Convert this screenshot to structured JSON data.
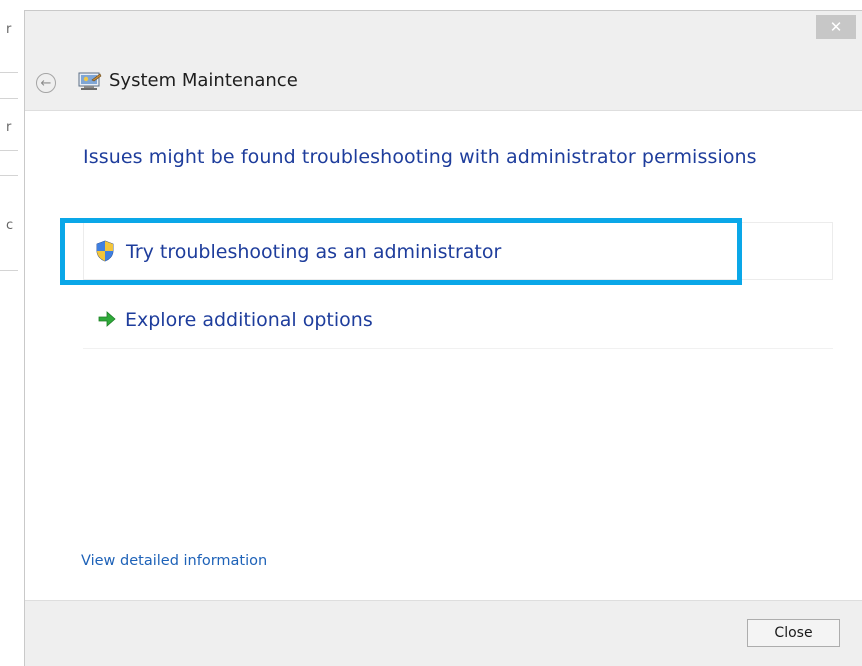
{
  "window": {
    "close_glyph": "✕",
    "title": "System Maintenance",
    "back_glyph": "←"
  },
  "content": {
    "heading": "Issues might be found troubleshooting with administrator permissions",
    "options": [
      {
        "label": "Try troubleshooting as an administrator",
        "icon": "uac-shield-icon",
        "highlighted": true
      },
      {
        "label": "Explore additional options",
        "icon": "green-arrow-icon",
        "highlighted": false
      }
    ],
    "detail_link": "View detailed information"
  },
  "footer": {
    "close_label": "Close"
  },
  "background_window": {
    "glyphs": [
      "r",
      "r",
      "c"
    ]
  },
  "colors": {
    "accent_link": "#1e3d9c",
    "highlight": "#0aa7e8",
    "arrow_green": "#2faa3a"
  }
}
